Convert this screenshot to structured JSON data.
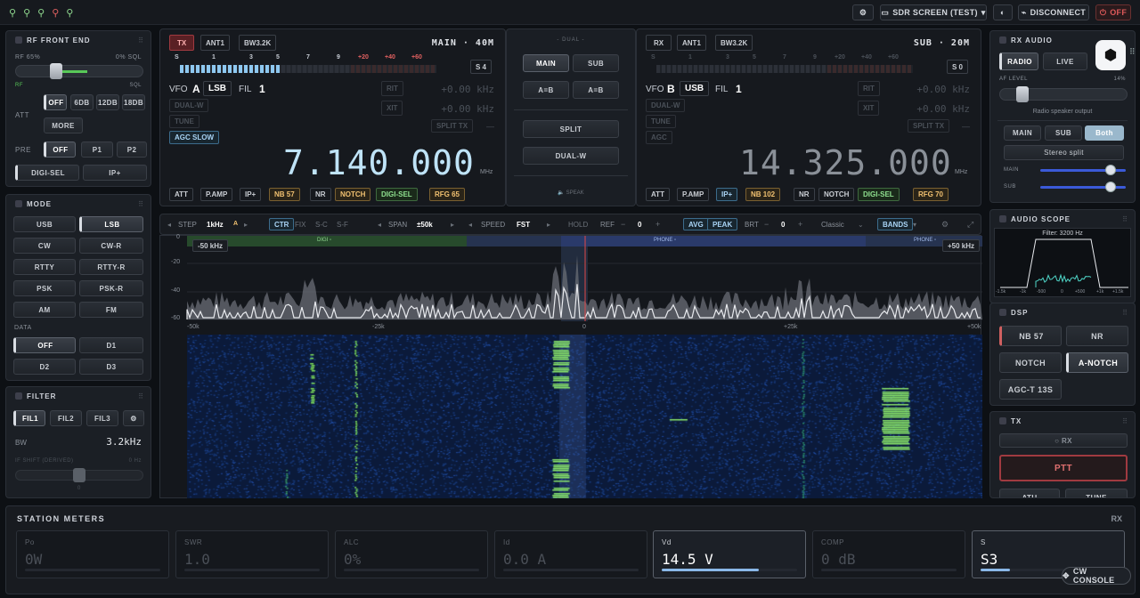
{
  "topbar": {
    "icons": [
      "antenna-icon",
      "antenna-icon",
      "antenna-icon",
      "antenna-off-icon",
      "antenna-icon"
    ],
    "sdr_screen": "SDR SCREEN (TEST)",
    "disconnect": "DISCONNECT",
    "power": "OFF"
  },
  "rf": {
    "title": "RF FRONT END",
    "rf_label": "RF 65%",
    "sql_label": "0% SQL",
    "rf_level": 0.65,
    "sql_level": 0,
    "rf_small": "RF",
    "sql_small": "SQL",
    "att_label": "ATT",
    "att": [
      "OFF",
      "6DB",
      "12DB",
      "18DB",
      "MORE"
    ],
    "pre_label": "PRE",
    "pre": [
      "OFF",
      "P1",
      "P2"
    ],
    "digisel": "DIGI-SEL",
    "ipplus": "IP+"
  },
  "mode": {
    "title": "MODE",
    "modes": [
      "USB",
      "LSB",
      "CW",
      "CW-R",
      "RTTY",
      "RTTY-R",
      "PSK",
      "PSK-R",
      "AM",
      "FM"
    ],
    "data_label": "DATA",
    "data": [
      "OFF",
      "D1",
      "D2",
      "D3"
    ]
  },
  "filter": {
    "title": "FILTER",
    "filters": [
      "FIL1",
      "FIL2",
      "FIL3",
      "⚙"
    ],
    "bw_label": "BW",
    "bw_value": "3.2kHz",
    "ifshift_label": "IF SHIFT (DERIVED)",
    "ifshift_value": "0 Hz",
    "ifshift_zero": "0"
  },
  "main": {
    "tx": "TX",
    "ant": "ANT1",
    "bw": "BW3.2K",
    "label": "MAIN · 40M",
    "s_value": "S 4",
    "s_scale": [
      "S",
      "1",
      "3",
      "5",
      "7",
      "9",
      "+20",
      "+40",
      "+60"
    ],
    "s_level": 0.38,
    "vfo": "VFO",
    "vfo_id": "A",
    "mode": "LSB",
    "fil": "FIL",
    "fil_num": "1",
    "rit": "RIT",
    "rit_val": "+0.00 kHz",
    "xit": "XIT",
    "xit_val": "+0.00 kHz",
    "dualw": "DUAL-W",
    "tune": "TUNE",
    "split_tx": "SPLIT TX",
    "split_dash": "—",
    "agc": "AGC SLOW",
    "freq": "7.140.000",
    "unit": "MHz",
    "bottom": [
      "ATT",
      "P.AMP",
      "IP+",
      "NB 57",
      "NR",
      "NOTCH",
      "DIGI-SEL",
      "RFG 65"
    ]
  },
  "dual": {
    "label": "DUAL",
    "main": "MAIN",
    "sub": "SUB",
    "aeqb": "A=B",
    "aeqb2": "A=B",
    "split": "SPLIT",
    "dualw": "DUAL-W",
    "speak": "SPEAK"
  },
  "sub": {
    "rx": "RX",
    "ant": "ANT1",
    "bw": "BW3.2K",
    "label": "SUB · 20M",
    "s_value": "S 0",
    "s_scale": [
      "S",
      "1",
      "3",
      "5",
      "7",
      "9",
      "+20",
      "+40",
      "+60"
    ],
    "vfo": "VFO",
    "vfo_id": "B",
    "mode": "USB",
    "fil": "FIL",
    "fil_num": "1",
    "rit": "RIT",
    "rit_val": "+0.00 kHz",
    "xit": "XIT",
    "xit_val": "+0.00 kHz",
    "dualw": "DUAL-W",
    "tune": "TUNE",
    "agc": "AGC",
    "split_tx": "SPLIT TX",
    "split_dash": "—",
    "freq": "14.325.000",
    "unit": "MHz",
    "bottom": [
      "ATT",
      "P.AMP",
      "IP+",
      "NB 102",
      "NR",
      "NOTCH",
      "DIGI-SEL",
      "RFG 70"
    ]
  },
  "spectrum": {
    "step_label": "STEP",
    "step": "1kHz",
    "step_a": "A",
    "ctr": "CTR",
    "fix": "FIX",
    "sc": "S-C",
    "sf": "S-F",
    "span_label": "SPAN",
    "span": "±50k",
    "speed_label": "SPEED",
    "speed": "FST",
    "hold": "HOLD",
    "ref_label": "REF",
    "ref": "0",
    "avg": "AVG",
    "peak": "PEAK",
    "brt_label": "BRT",
    "brt": "0",
    "theme": "Classic",
    "bands": "BANDS",
    "left_edge": "-50 kHz",
    "right_edge": "+50 kHz",
    "band_digi": "DIGI ▫",
    "band_phone": "PHONE ▫",
    "band_phone2": "PHONE ▫",
    "y_ticks": [
      "0",
      "-20",
      "-40",
      "-60"
    ],
    "x_ticks": [
      "-50k",
      "-25k",
      "0",
      "+25k",
      "+50k"
    ]
  },
  "rxaudio": {
    "title": "RX AUDIO",
    "radio": "RADIO",
    "live": "LIVE",
    "af_label": "AF LEVEL",
    "af_value": "14%",
    "af_level": 0.14,
    "speaker": "Radio speaker output",
    "route": [
      "MAIN",
      "SUB",
      "Both"
    ],
    "stereo": "Stereo split",
    "main_label": "MAIN",
    "sub_label": "SUB"
  },
  "scope": {
    "title": "AUDIO SCOPE",
    "filter": "Filter: 3200 Hz",
    "x_ticks": [
      "-1.5k",
      "-1k",
      "-500",
      "0",
      "+500",
      "+1k",
      "+1.5k"
    ]
  },
  "dsp": {
    "title": "DSP",
    "buttons": [
      "NB 57",
      "NR",
      "NOTCH",
      "A-NOTCH",
      "AGC-T 13S"
    ]
  },
  "tx": {
    "title": "TX",
    "rx": "○ RX",
    "ptt": "PTT",
    "atu": "ATU",
    "tune": "TUNE"
  },
  "meters": {
    "title": "STATION METERS",
    "mode": "RX",
    "items": [
      {
        "name": "Po",
        "value": "0W",
        "level": 0
      },
      {
        "name": "SWR",
        "value": "1.0",
        "level": 0
      },
      {
        "name": "ALC",
        "value": "0%",
        "level": 0
      },
      {
        "name": "Id",
        "value": "0.0 A",
        "level": 0
      },
      {
        "name": "Vd",
        "value": "14.5 V",
        "level": 0.72
      },
      {
        "name": "COMP",
        "value": "0 dB",
        "level": 0
      },
      {
        "name": "S",
        "value": "S3",
        "level": 0.22
      }
    ],
    "cw_console": "CW CONSOLE"
  }
}
